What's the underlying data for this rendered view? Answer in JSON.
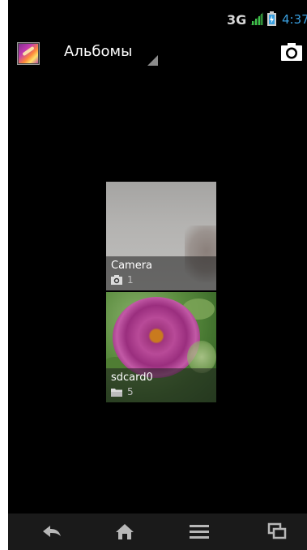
{
  "status_bar": {
    "network": "3G",
    "time": "4:37",
    "signal_icon": "signal-icon",
    "battery_icon": "battery-icon"
  },
  "action_bar": {
    "title": "Альбомы",
    "app_icon": "gallery-app-icon",
    "camera_icon": "camera-icon"
  },
  "albums": [
    {
      "name": "Camera",
      "count": "1",
      "type_icon": "camera-small-icon"
    },
    {
      "name": "sdcard0",
      "count": "5",
      "type_icon": "folder-icon"
    }
  ],
  "nav_bar": {
    "back_icon": "back-icon",
    "home_icon": "home-icon",
    "menu_icon": "menu-icon",
    "recents_icon": "recent-apps-icon"
  },
  "colors": {
    "clock": "#3aa0e0",
    "background": "#000000",
    "navbar": "#1a1a1a"
  }
}
